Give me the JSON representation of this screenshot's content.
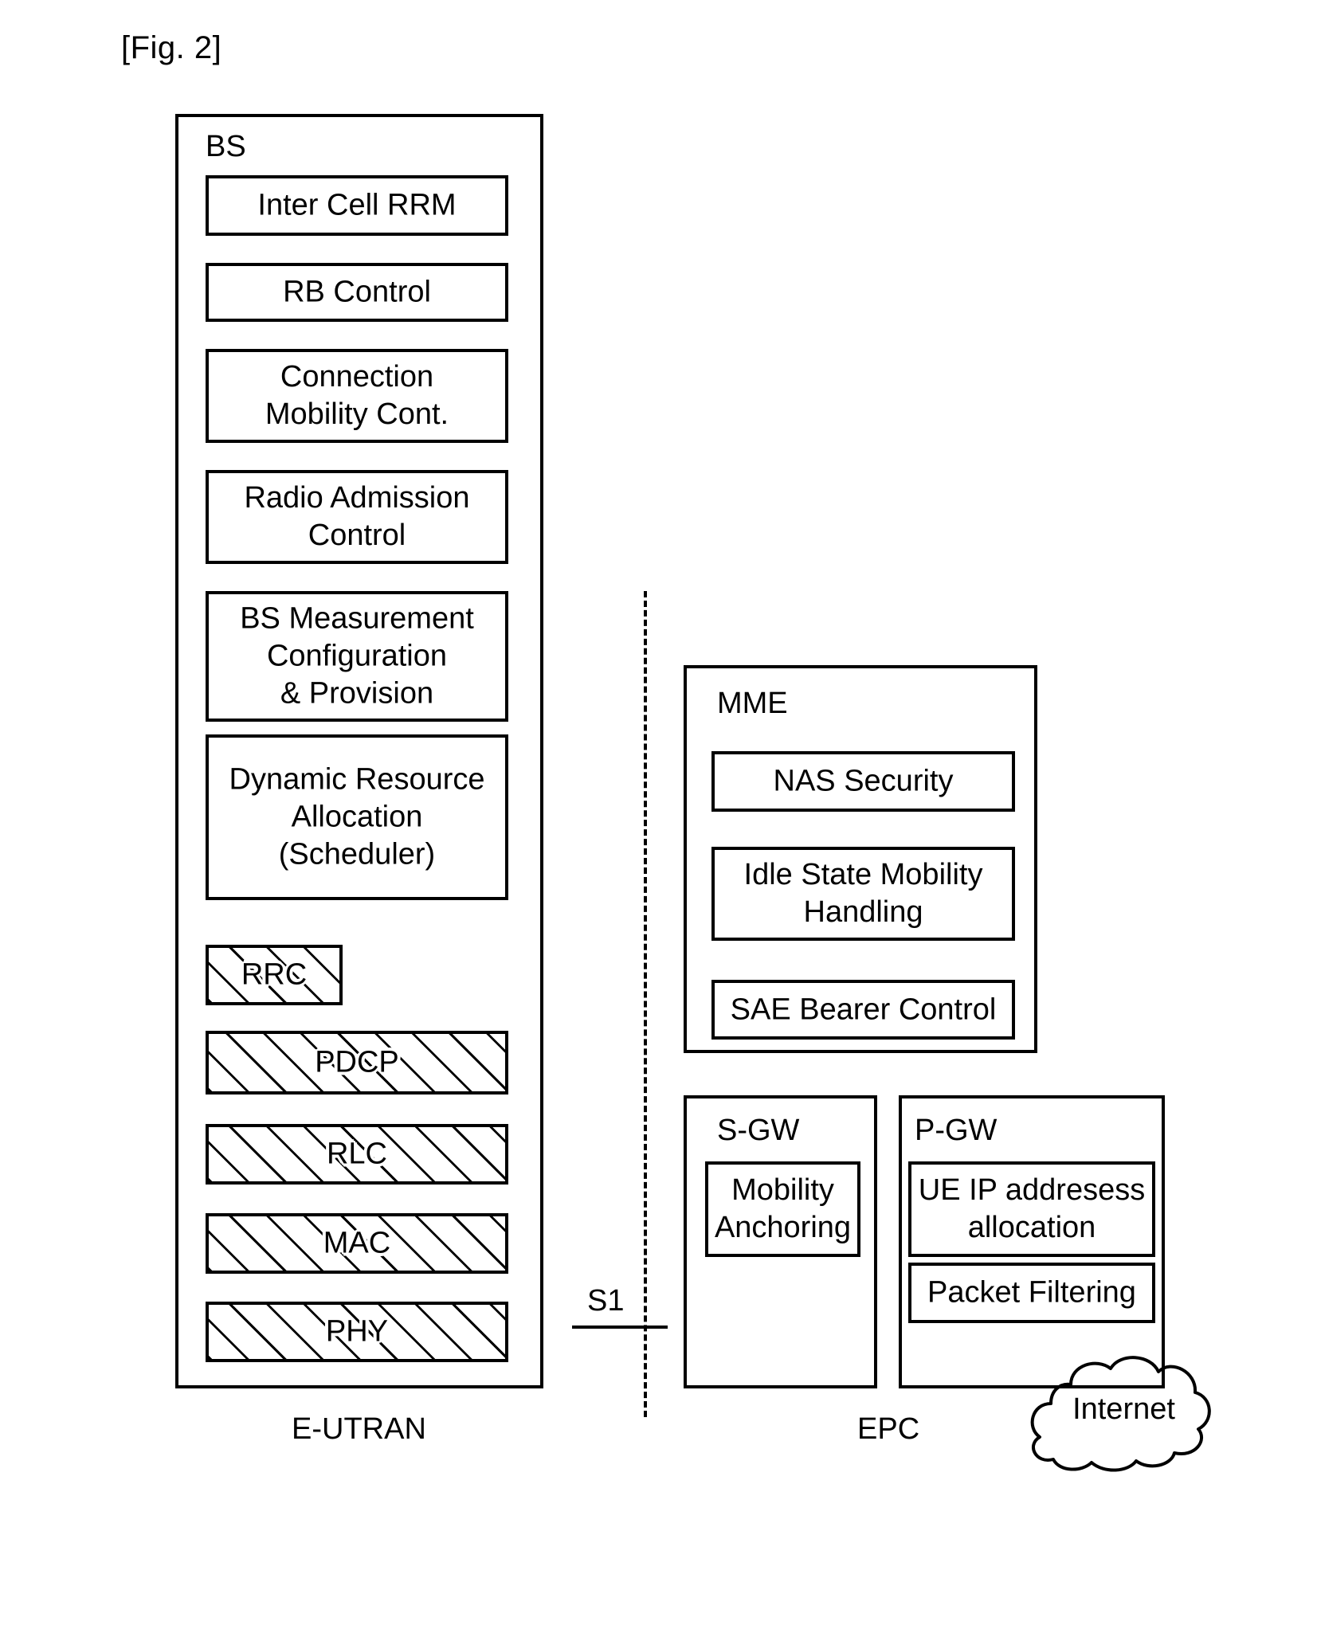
{
  "figure": {
    "caption": "[Fig. 2]"
  },
  "colors": {
    "stroke": "#000000",
    "background": "#ffffff"
  },
  "eutran": {
    "region_label": "E-UTRAN",
    "container_title": "BS",
    "modules": [
      {
        "label": "Inter Cell RRM",
        "hatched": false
      },
      {
        "label": "RB Control",
        "hatched": false
      },
      {
        "label": "Connection\nMobility Cont.",
        "hatched": false
      },
      {
        "label": "Radio Admission\nControl",
        "hatched": false
      },
      {
        "label": "BS Measurement\nConfiguration\n& Provision",
        "hatched": false
      },
      {
        "label": "Dynamic Resource\nAllocation\n(Scheduler)",
        "hatched": false
      },
      {
        "label": "RRC",
        "hatched": true
      },
      {
        "label": "PDCP",
        "hatched": true
      },
      {
        "label": "RLC",
        "hatched": true
      },
      {
        "label": "MAC",
        "hatched": true
      },
      {
        "label": "PHY",
        "hatched": true
      }
    ]
  },
  "interface": {
    "label": "S1"
  },
  "epc": {
    "region_label": "EPC",
    "nodes": [
      {
        "title": "MME",
        "modules": [
          {
            "label": "NAS Security"
          },
          {
            "label": "Idle State Mobility\nHandling"
          },
          {
            "label": "SAE Bearer Control"
          }
        ]
      },
      {
        "title": "S-GW",
        "modules": [
          {
            "label": "Mobility\nAnchoring"
          }
        ]
      },
      {
        "title": "P-GW",
        "modules": [
          {
            "label": "UE IP addresess\nallocation"
          },
          {
            "label": "Packet Filtering"
          }
        ]
      }
    ]
  },
  "internet": {
    "label": "Internet"
  }
}
